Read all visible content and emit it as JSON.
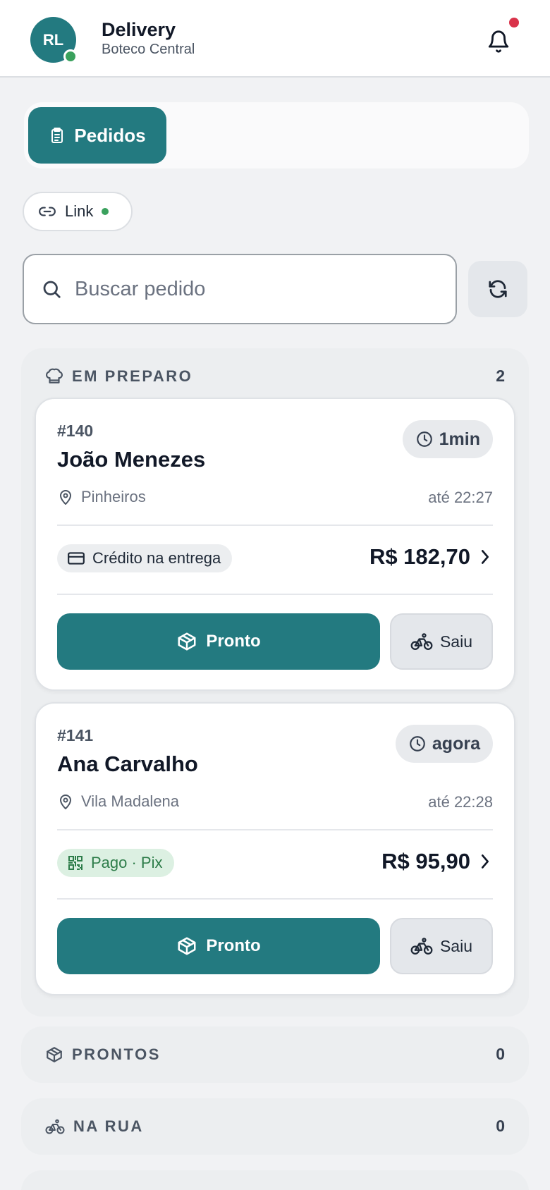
{
  "header": {
    "avatar_initials": "RL",
    "title": "Delivery",
    "subtitle": "Boteco Central"
  },
  "tabs": [
    {
      "label": "Pedidos",
      "active": true
    }
  ],
  "link_chip": {
    "label": "Link",
    "status_color": "#3aa15d"
  },
  "search": {
    "placeholder": "Buscar pedido",
    "value": ""
  },
  "sections": {
    "preparing": {
      "label": "EM PREPARO",
      "count": "2"
    },
    "ready": {
      "label": "PRONTOS",
      "count": "0"
    },
    "on_street": {
      "label": "NA RUA",
      "count": "0"
    }
  },
  "orders": [
    {
      "number": "#140",
      "customer": "João Menezes",
      "elapsed": "1min",
      "neighborhood": "Pinheiros",
      "eta": "até 22:27",
      "payment": "Crédito na entrega",
      "payment_icon": "credit-card-icon",
      "total": "R$ 182,70",
      "ready_label": "Pronto",
      "out_label": "Saiu"
    },
    {
      "number": "#141",
      "customer": "Ana Carvalho",
      "elapsed": "agora",
      "neighborhood": "Vila Madalena",
      "eta": "até 22:28",
      "payment": "Pago · Pix",
      "payment_icon": "qr-code-icon",
      "total": "R$ 95,90",
      "ready_label": "Pronto",
      "out_label": "Saiu"
    }
  ],
  "colors": {
    "brand": "#237a80",
    "online": "#3aa15d",
    "notification": "#d9334a",
    "paid_bg": "#dcf0e2",
    "paid_text": "#2e7d4a"
  }
}
